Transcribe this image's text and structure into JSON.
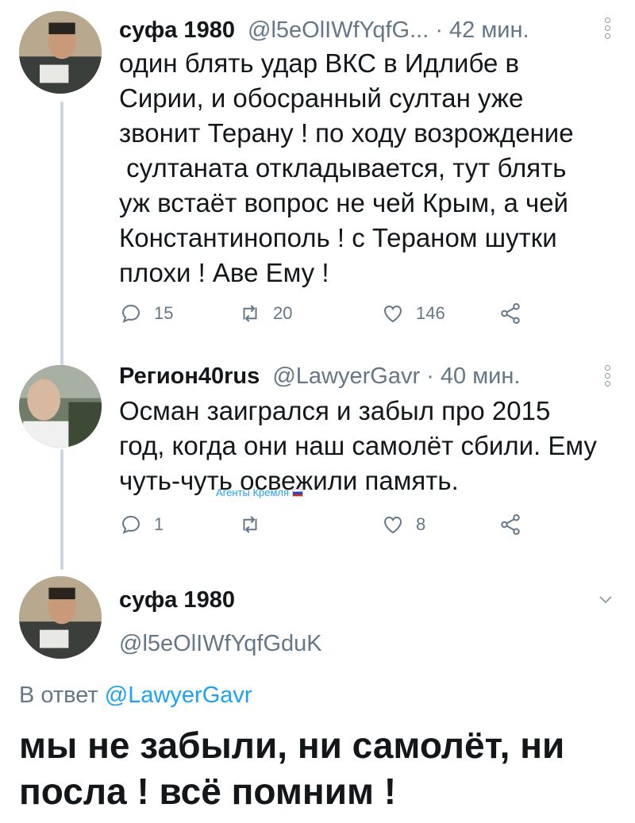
{
  "tweets": [
    {
      "name": "суфа 1980",
      "handle": "@l5eOlIWfYqfG...",
      "time": "· 42 мин.",
      "text": "один блять удар ВКС в Идлибе в\nСирии, и обосранный султан уже\nзвонит Терану ! по ходу возрождение\n султаната откладывается, тут блять\nуж встаёт вопрос не чей Крым, а чей\nКонстантинополь ! с Тераном шутки\nплохи ! Аве Ему !",
      "replies": "15",
      "retweets": "20",
      "likes": "146"
    },
    {
      "name": "Регион40rus",
      "handle": "@LawyerGavr",
      "time": "· 40 мин.",
      "text": "Осман заигрался и забыл про 2015\nгод, когда они наш самолёт сбили. Ему\nчуть-чуть освежили память.",
      "replies": "1",
      "retweets": "",
      "likes": "8"
    }
  ],
  "watermark": "Агенты Кремля",
  "main_tweet": {
    "name": "суфа 1980",
    "handle": "@l5eOlIWfYqfGduK",
    "reply_prefix": "В ответ",
    "reply_to": "@LawyerGavr",
    "text": "мы не забыли, ни самолёт, ни\nпосла ! всё помним !"
  },
  "icons": {
    "reply": "reply-icon",
    "retweet": "retweet-icon",
    "like": "heart-icon",
    "share": "share-icon",
    "menu": "vertical-dots-icon",
    "caret": "chevron-down-icon"
  },
  "colors": {
    "text": "#14171a",
    "secondary": "#657786",
    "link": "#1da1f2",
    "thread": "#ccd6dd"
  }
}
